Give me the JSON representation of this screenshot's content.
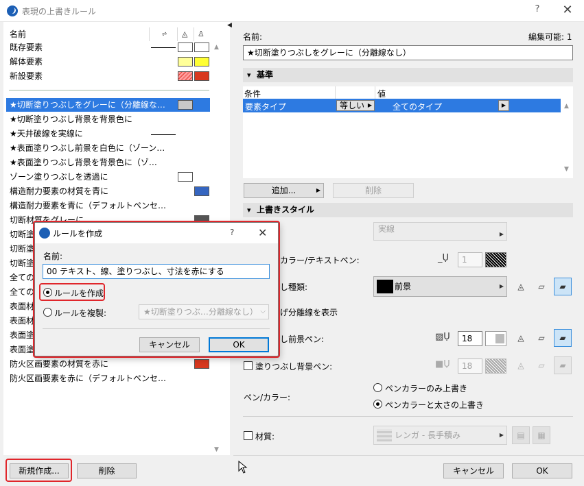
{
  "window": {
    "title": "表現の上書きルール",
    "help": "?",
    "close": "✕"
  },
  "left": {
    "header": {
      "name_col": "名前"
    },
    "state_rows": [
      {
        "label": "既存要素"
      },
      {
        "label": "解体要素"
      },
      {
        "label": "新設要素"
      }
    ],
    "rules": [
      {
        "label": "★切断塗りつぶしをグレーに（分離線な…"
      },
      {
        "label": "★切断塗りつぶし背景を背景色に"
      },
      {
        "label": "★天井破線を実線に"
      },
      {
        "label": "★表面塗りつぶし前景を白色に（ゾーン…"
      },
      {
        "label": "★表面塗りつぶし背景を背景色に（ゾ…"
      },
      {
        "label": "ゾーン塗りつぶしを透過に"
      },
      {
        "label": "構造耐力要素の材質を青に"
      },
      {
        "label": "構造耐力要素を青に（デフォルトペンセ…"
      },
      {
        "label": "切断材質をグレーに"
      },
      {
        "label": "切断塗"
      },
      {
        "label": "切断塗"
      },
      {
        "label": "切断塗"
      },
      {
        "label": "全ての"
      },
      {
        "label": "全ての"
      },
      {
        "label": "表面材"
      },
      {
        "label": "表面材"
      },
      {
        "label": "表面塗"
      },
      {
        "label": "表面塗"
      },
      {
        "label": "防火区画要素の材質を赤に"
      },
      {
        "label": "防火区画要素を赤に（デフォルトペンセ…"
      }
    ],
    "new_button": "新規作成...",
    "delete_button": "削除"
  },
  "right": {
    "name_label": "名前:",
    "editable_label": "編集可能: 1",
    "name_value": "★切断塗りつぶしをグレーに（分離線なし）",
    "criteria": {
      "title": "基準",
      "col_condition": "条件",
      "col_value": "値",
      "row": {
        "condition": "要素タイプ",
        "operator": "等しい",
        "value": "全てのタイプ"
      },
      "add_button": "追加...",
      "delete_button": "削除"
    },
    "style": {
      "title": "上書きスタイル",
      "line_type": "実線",
      "line_pen_label": "カラー/テキストペン:",
      "line_pen_value": "1",
      "fill_type_label": "し種類:",
      "fill_type_value": "前景",
      "separator_label": "げ分離線を表示",
      "fg_pen_label": "し前景ペン:",
      "fg_pen_value": "18",
      "bg_pen_label": "塗りつぶし背景ペン:",
      "bg_pen_value": "18",
      "pen_color_label": "ペン/カラー:",
      "radio_pen_only": "ペンカラーのみ上書き",
      "radio_pen_weight": "ペンカラーと太さの上書き",
      "material_label": "材質:",
      "material_value": "レンガ - 長手積み"
    },
    "cancel_button": "キャンセル",
    "ok_button": "OK"
  },
  "dialog": {
    "title": "ルールを作成",
    "help": "?",
    "close": "✕",
    "name_label": "名前:",
    "name_value": "00 テキスト、線、塗りつぶし、寸法を赤にする",
    "radio_create": "ルールを作成",
    "radio_duplicate": "ルールを複製:",
    "duplicate_source": "★切断塗りつぶ…分離線なし）",
    "cancel_button": "キャンセル",
    "ok_button": "OK"
  },
  "colors": {
    "selection": "#2d7ae1",
    "highlight_red": "#e0262b",
    "blue_swatch": "#3565c0",
    "red_swatch": "#d8381e",
    "yellow_swatch": "#ffff33"
  }
}
